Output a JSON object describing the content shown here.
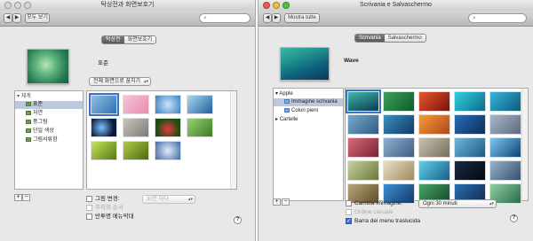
{
  "left": {
    "title": "탁상전과 화면보호기",
    "show_all": "모두 보기",
    "tabs": [
      "탁상전",
      "화면보호기"
    ],
    "current_name": "표준",
    "position_select": "전체 화면으로 꿈치기",
    "tree": {
      "header": "체계",
      "items": [
        "표준",
        "자연",
        "풍그림",
        "단일 색상",
        "그림서류함"
      ]
    },
    "change_picture": "그림 변경:",
    "change_interval": "30분 마다",
    "random_order": "무작위 순서",
    "translucent_menu": "반투명 메뉴막대",
    "help": "?",
    "add": "+",
    "remove": "−"
  },
  "right": {
    "title": "Scrivania e Salvaschermo",
    "show_all": "Mostra tutte",
    "tabs": [
      "Scrivania",
      "Salvaschermo"
    ],
    "current_name": "Wave",
    "tree": {
      "group_apple": "Apple",
      "item_desktop": "Immagine scrivania",
      "item_colors": "Colori pieni",
      "group_folders": "Cartelle"
    },
    "change_picture": "Cambia immagine:",
    "change_interval": "Ogni 30 minuti",
    "random_order": "Ordine casuale",
    "translucent_menu": "Barra dei menu traslucida",
    "help": "?",
    "add": "+",
    "remove": "−"
  },
  "colors": {
    "selection": "#bcc8dc",
    "accent": "#3a73c9"
  }
}
